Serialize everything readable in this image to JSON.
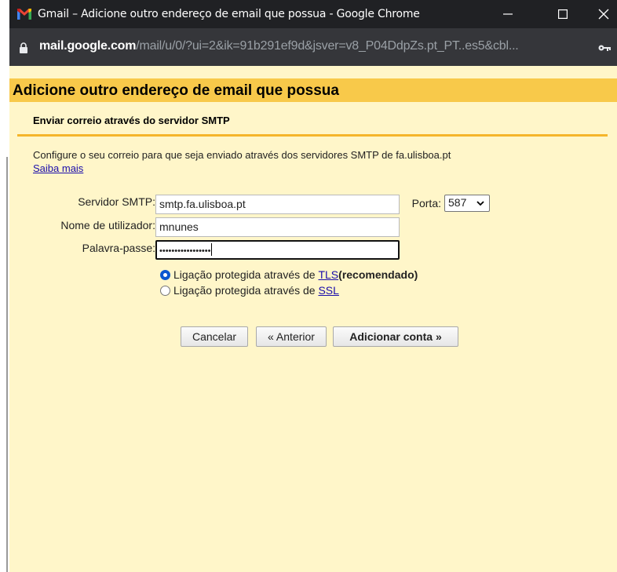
{
  "window": {
    "title": "Gmail – Adicione outro endereço de email que possua - Google Chrome",
    "url_host": "mail.google.com",
    "url_path": "/mail/u/0/?ui=2&ik=91b291ef9d&jsver=v8_P04DdpZs.pt_PT..es5&cbl...",
    "icons": [
      "gmail-icon",
      "minimize-icon",
      "maximize-icon",
      "close-icon",
      "lock-icon",
      "key-icon"
    ]
  },
  "dialog": {
    "heading": "Adicione outro endereço de email que possua",
    "subtitle": "Enviar correio através do servidor SMTP",
    "description": "Configure o seu correio para que seja enviado através dos servidores SMTP de fa.ulisboa.pt",
    "learn_more": "Saiba mais"
  },
  "form": {
    "server_label": "Servidor SMTP:",
    "server_value": "smtp.fa.ulisboa.pt",
    "port_label": "Porta:",
    "port_value": "587",
    "username_label": "Nome de utilizador:",
    "username_value": "mnunes",
    "password_label": "Palavra-passe:",
    "password_mask": "•••••••••••••••••",
    "tls_prefix": "Ligação protegida através de ",
    "tls_link": "TLS",
    "tls_suffix": "(recomendado)",
    "ssl_prefix": "Ligação protegida através de ",
    "ssl_link": "SSL",
    "selected_security": "TLS"
  },
  "buttons": {
    "cancel": "Cancelar",
    "previous": "« Anterior",
    "add_account": "Adicionar conta »"
  },
  "colors": {
    "titlebar": "#202124",
    "urlbar": "#35363a",
    "header": "#f8c94a",
    "background": "#fff6c9",
    "divider": "#f5b52a",
    "link": "#1a0dab"
  }
}
